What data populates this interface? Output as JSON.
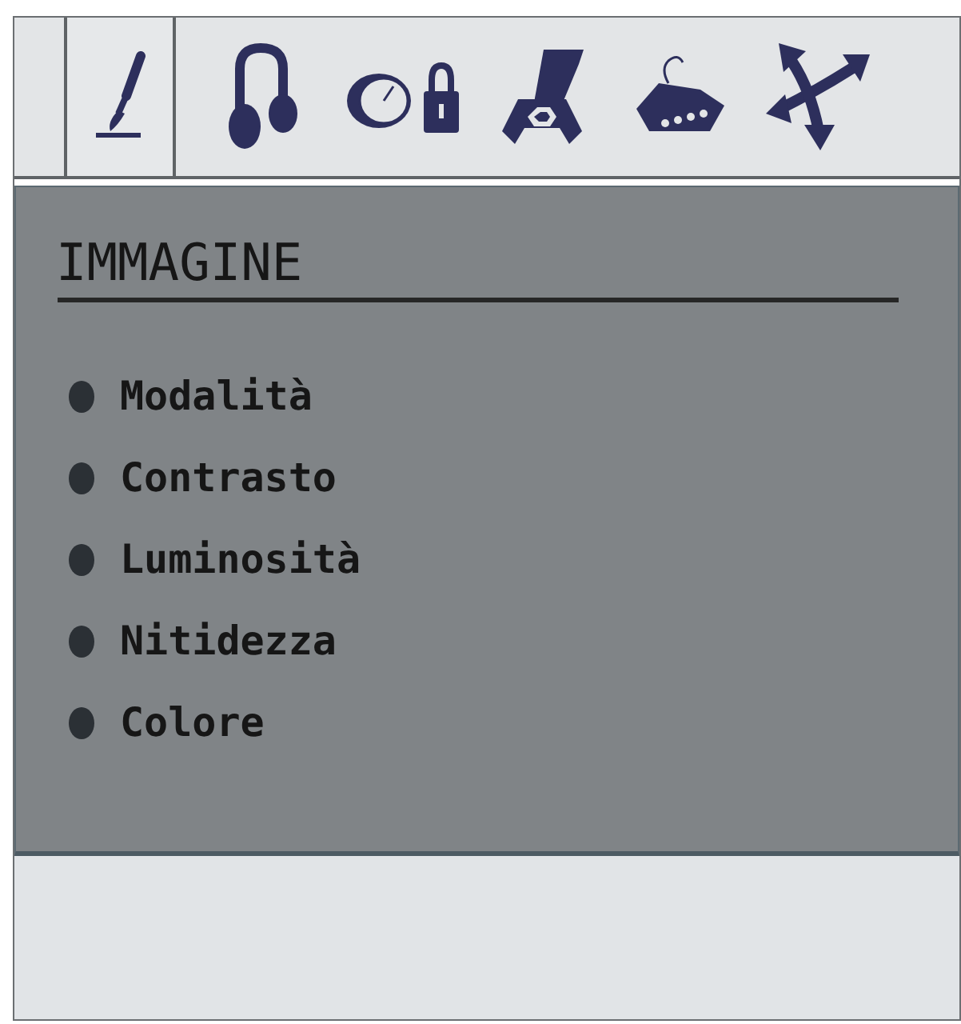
{
  "tabs": [
    {
      "kind": "brush",
      "selected": true
    },
    {
      "kind": "headphones",
      "selected": false
    },
    {
      "kind": "clocklock",
      "selected": false
    },
    {
      "kind": "wrench",
      "selected": false
    },
    {
      "kind": "connector",
      "selected": false
    },
    {
      "kind": "arrows",
      "selected": false
    }
  ],
  "menu": {
    "title": "IMMAGINE",
    "items": [
      "Modalità",
      "Contrasto",
      "Luminosità",
      "Nitidezza",
      "Colore"
    ]
  }
}
